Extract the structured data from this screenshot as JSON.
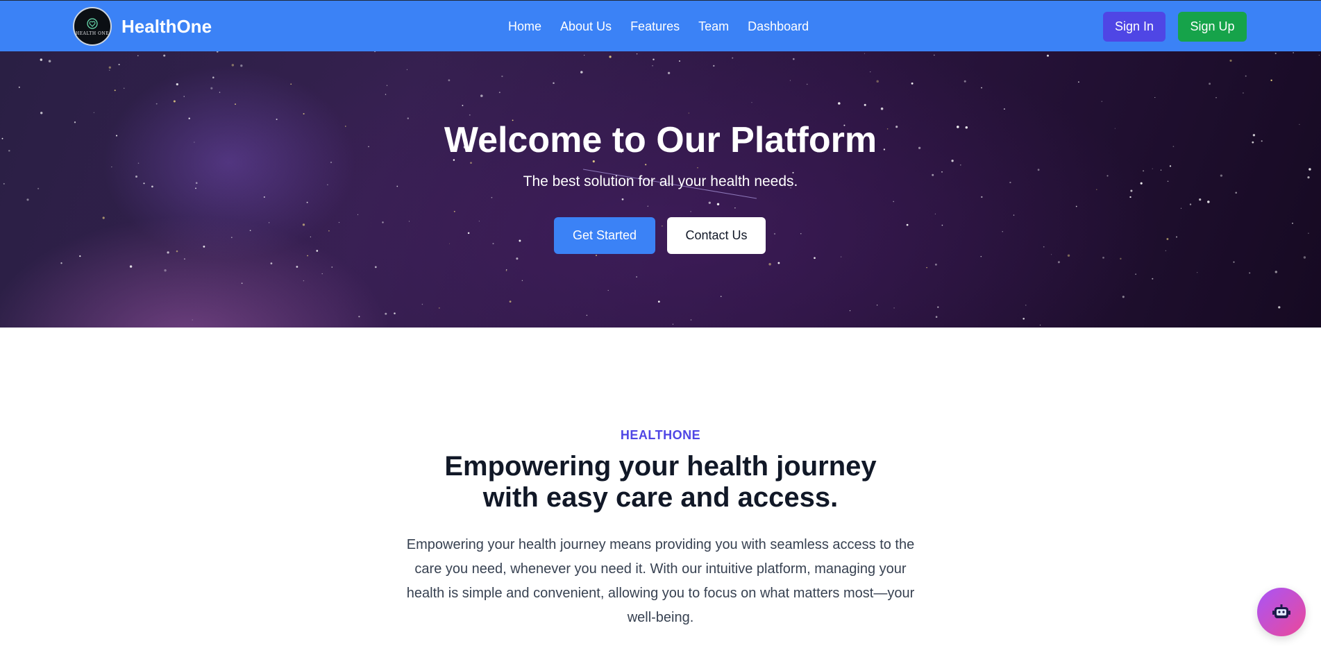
{
  "navbar": {
    "brand_name": "HealthOne",
    "logo_text": "HEALTH ONE",
    "links": [
      "Home",
      "About Us",
      "Features",
      "Team",
      "Dashboard"
    ],
    "signin_label": "Sign In",
    "signup_label": "Sign Up",
    "colors": {
      "background": "#3b82f6",
      "signin": "#4f46e5",
      "signup": "#16a34a"
    }
  },
  "hero": {
    "title": "Welcome to Our Platform",
    "subtitle": "The best solution for all your health needs.",
    "primary_cta": "Get Started",
    "secondary_cta": "Contact Us"
  },
  "about": {
    "eyebrow": "HEALTHONE",
    "title": "Empowering your health journey with easy care and access.",
    "body": "Empowering your health journey means providing you with seamless access to the care you need, whenever you need it. With our intuitive platform, managing your health is simple and convenient, allowing you to focus on what matters most—your well-being."
  },
  "chat_widget": {
    "icon": "robot-icon"
  }
}
